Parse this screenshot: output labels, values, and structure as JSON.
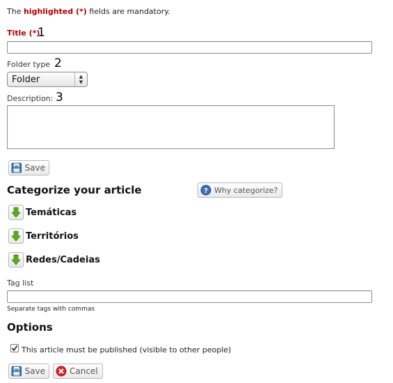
{
  "notice": {
    "prefix": "The ",
    "highlight": "highlighted (*)",
    "suffix": " fields are mandatory."
  },
  "fields": {
    "title": {
      "label": "Title (*)",
      "marker": "1",
      "value": ""
    },
    "folder_type": {
      "label": "Folder type",
      "marker": "2",
      "selected": "Folder"
    },
    "description": {
      "label": "Description:",
      "marker": "3",
      "value": ""
    }
  },
  "buttons": {
    "save_top": "Save",
    "why_categorize": "Why categorize?",
    "save_bottom": "Save",
    "cancel": "Cancel"
  },
  "categorize": {
    "heading": "Categorize your article",
    "items": [
      "Temáticas",
      "Territórios",
      "Redes/Cadeias"
    ]
  },
  "tags": {
    "label": "Tag list",
    "value": "",
    "hint": "Separate tags with commas"
  },
  "options": {
    "heading": "Options",
    "publish_label": "This article must be published (visible to other people)",
    "publish_checked": true
  },
  "colors": {
    "mandatory": "#b00000",
    "arrow_green": "#5aac1f",
    "cancel_red": "#d9262b",
    "help_blue": "#3b6fb6"
  }
}
